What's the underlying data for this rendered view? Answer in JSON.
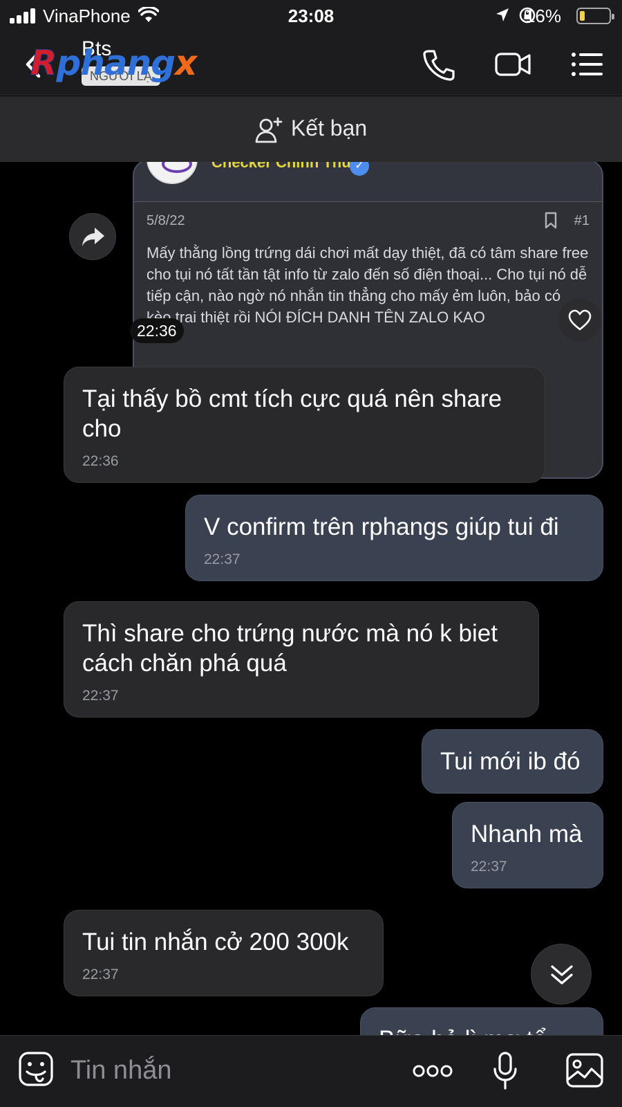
{
  "status_bar": {
    "carrier": "VinaPhone",
    "time": "23:08",
    "battery_percent": "16%"
  },
  "header": {
    "contact_name": "Bts",
    "badge": "NGƯỜI LẠ",
    "watermark": [
      "R",
      "phang",
      "x"
    ]
  },
  "friend_bar": {
    "label": "Kết bạn"
  },
  "shared_post": {
    "title": "Checker Chính Thức",
    "date": "5/8/22",
    "post_number": "#1",
    "text": "Mấy thằng lồng trứng dái chơi mất dạy thiệt, đã có tâm share free cho tụi nó tất tần tật info từ zalo đến số điện thoại... Cho tụi nó dễ tiếp cận, nào ngờ nó nhắn tin thẳng cho mấy ẻm luôn, bảo có kèo trai thiệt rồi NÓI ĐÍCH DANH TÊN ZALO KAO",
    "time": "22:36"
  },
  "messages": [
    {
      "direction": "in",
      "text": "Tại thấy bồ cmt tích cực quá nên share cho",
      "time": "22:36"
    },
    {
      "direction": "out",
      "text": "V confirm trên rphangs giúp tui đi",
      "time": "22:37"
    },
    {
      "direction": "in",
      "text": "Thì share cho trứng nước mà nó k biet cách chăn phá quá",
      "time": "22:37"
    },
    {
      "direction": "out",
      "text": "Tui mới ib đó",
      "time": ""
    },
    {
      "direction": "out",
      "text": "Nhanh mà",
      "time": "22:37"
    },
    {
      "direction": "in",
      "text": "Tui tin nhắn cở 200 300k",
      "time": "22:37"
    },
    {
      "direction": "out",
      "text": "Bữa hả lì mơ tể",
      "time": ""
    }
  ],
  "input_bar": {
    "placeholder": "Tin nhắn"
  },
  "colors": {
    "incoming_bubble": "#29292b",
    "outgoing_bubble": "#3a4150",
    "background": "#000000"
  }
}
